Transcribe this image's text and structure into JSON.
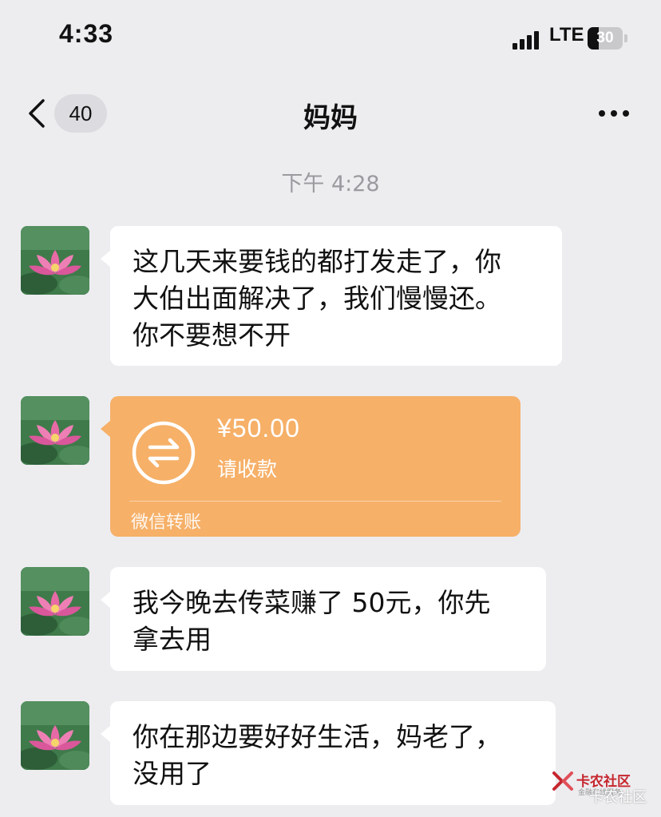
{
  "status_bar": {
    "time": "4:33",
    "network": "LTE",
    "battery": "30"
  },
  "nav": {
    "unread_count": "40",
    "title": "妈妈"
  },
  "timestamp": "下午 4:28",
  "messages": [
    {
      "type": "text",
      "lines": [
        "这几天来要钱的都打发走了，你",
        "大伯出面解决了，我们慢慢还。",
        "你不要想不开"
      ]
    },
    {
      "type": "transfer",
      "amount": "¥50.00",
      "status": "请收款",
      "label": "微信转账"
    },
    {
      "type": "text",
      "lines": [
        "我今晚去传菜赚了 50元，你先",
        "拿去用"
      ]
    },
    {
      "type": "text",
      "lines": [
        "你在那边要好好生活，妈老了，",
        "没用了"
      ]
    }
  ],
  "watermark": {
    "brand": "卡农社区",
    "tagline": "金融在线服务",
    "overlay": "卡农社区"
  },
  "colors": {
    "background": "#ededf0",
    "bubble": "#ffffff",
    "transfer": "#f6b068",
    "timestamp": "#9b9b9f",
    "watermark": "#c6262e"
  },
  "icons": [
    "back-chevron-icon",
    "more-dots-icon",
    "signal-icon",
    "battery-icon",
    "lotus-avatar",
    "transfer-arrows-icon",
    "kanong-logo-icon"
  ]
}
